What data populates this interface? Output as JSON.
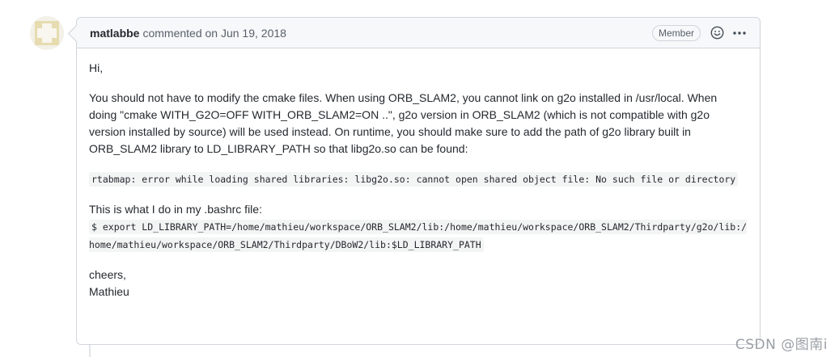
{
  "comment": {
    "author": "matlabbe",
    "meta": "commented on Jun 19, 2018",
    "badge": "Member",
    "icons": {
      "reaction": "smiley-icon",
      "more": "kebab-menu-icon"
    },
    "body": {
      "greeting": "Hi,",
      "paragraph": "You should not have to modify the cmake files. When using ORB_SLAM2, you cannot link on g2o installed in /usr/local. When doing \"cmake WITH_G2O=OFF WITH_ORB_SLAM2=ON ..\", g2o version in ORB_SLAM2 (which is not compatible with g2o version installed by source) will be used instead. On runtime, you should make sure to add the path of g2o library built in ORB_SLAM2 library to LD_LIBRARY_PATH so that libg2o.so can be found:",
      "error_code": "rtabmap: error while loading shared libraries: libg2o.so: cannot open shared object file: No such file or directory",
      "bashrc_intro": "This is what I do in my .bashrc file:",
      "export_code": "$ export LD_LIBRARY_PATH=/home/mathieu/workspace/ORB_SLAM2/lib:/home/mathieu/workspace/ORB_SLAM2/Thirdparty/g2o/lib:/home/mathieu/workspace/ORB_SLAM2/Thirdparty/DBoW2/lib:$LD_LIBRARY_PATH",
      "signoff_1": "cheers,",
      "signoff_2": "Mathieu"
    }
  },
  "watermark": "CSDN @图南i",
  "colors": {
    "border": "#d1d5da",
    "header_bg": "#f6f8fa",
    "text": "#24292e",
    "muted": "#586069"
  }
}
